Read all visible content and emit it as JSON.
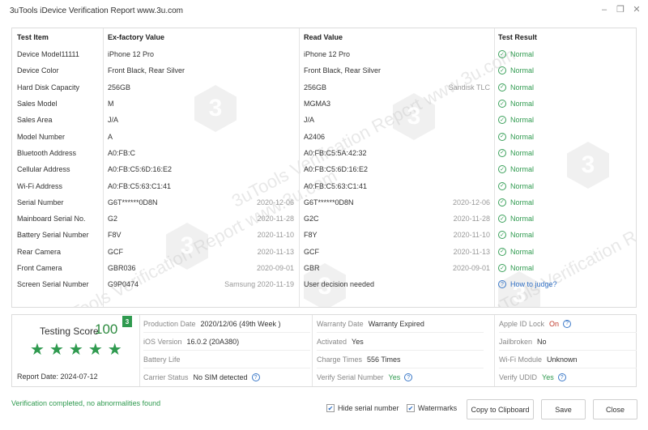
{
  "window": {
    "title": "3uTools iDevice Verification Report www.3u.com",
    "minimize_icon": "minimize-icon",
    "restore_icon": "restore-icon",
    "close_icon": "close-icon"
  },
  "table": {
    "headers": {
      "item": "Test Item",
      "ex_factory": "Ex-factory Value",
      "read": "Read Value",
      "result": "Test Result"
    },
    "rows": [
      {
        "item": "Device Model11111",
        "ex": "iPhone 12 Pro",
        "ex_sub": "",
        "read": "iPhone 12 Pro",
        "read_sub": "",
        "result": "Normal",
        "status": "ok"
      },
      {
        "item": "Device Color",
        "ex": "Front Black,  Rear Silver",
        "ex_sub": "",
        "read": "Front Black,  Rear Silver",
        "read_sub": "",
        "result": "Normal",
        "status": "ok"
      },
      {
        "item": "Hard Disk Capacity",
        "ex": "256GB",
        "ex_sub": "",
        "read": "256GB",
        "read_sub": "Sandisk TLC",
        "result": "Normal",
        "status": "ok"
      },
      {
        "item": "Sales Model",
        "ex": "M",
        "ex_sub": "",
        "read": "MGMA3",
        "read_sub": "",
        "result": "Normal",
        "status": "ok"
      },
      {
        "item": "Sales Area",
        "ex": "J/A",
        "ex_sub": "",
        "read": "J/A",
        "read_sub": "",
        "result": "Normal",
        "status": "ok"
      },
      {
        "item": "Model Number",
        "ex": "A",
        "ex_sub": "",
        "read": "A2406",
        "read_sub": "",
        "result": "Normal",
        "status": "ok"
      },
      {
        "item": "Bluetooth Address",
        "ex": "A0:FB:C",
        "ex_sub": "",
        "read": "A0:FB:C5:5A:42:32",
        "read_sub": "",
        "result": "Normal",
        "status": "ok"
      },
      {
        "item": "Cellular Address",
        "ex": "A0:FB:C5:6D:16:E2",
        "ex_sub": "",
        "read": "A0:FB:C5:6D:16:E2",
        "read_sub": "",
        "result": "Normal",
        "status": "ok"
      },
      {
        "item": "Wi-Fi Address",
        "ex": "A0:FB:C5:63:C1:41",
        "ex_sub": "",
        "read": "A0:FB:C5:63:C1:41",
        "read_sub": "",
        "result": "Normal",
        "status": "ok"
      },
      {
        "item": "Serial Number",
        "ex": "G6T******0D8N",
        "ex_sub": "2020-12-06",
        "read": "G6T******0D8N",
        "read_sub": "2020-12-06",
        "result": "Normal",
        "status": "ok"
      },
      {
        "item": "Mainboard Serial No.",
        "ex": "G2",
        "ex_sub": "2020-11-28",
        "read": "G2C",
        "read_sub": "2020-11-28",
        "result": "Normal",
        "status": "ok"
      },
      {
        "item": "Battery Serial Number",
        "ex": "F8V",
        "ex_sub": "2020-11-10",
        "read": "F8Y",
        "read_sub": "2020-11-10",
        "result": "Normal",
        "status": "ok"
      },
      {
        "item": "Rear Camera",
        "ex": "GCF",
        "ex_sub": "2020-11-13",
        "read": "GCF",
        "read_sub": "2020-11-13",
        "result": "Normal",
        "status": "ok"
      },
      {
        "item": "Front Camera",
        "ex": "GBR036",
        "ex_sub": "2020-09-01",
        "read": "GBR",
        "read_sub": "2020-09-01",
        "result": "Normal",
        "status": "ok"
      },
      {
        "item": "Screen Serial Number",
        "ex": "G9P0474",
        "ex_sub": "Samsung 2020-11-19",
        "read": "User decision needed",
        "read_sub": "",
        "result": "How to judge?",
        "status": "question"
      }
    ]
  },
  "summary": {
    "score_label": "Testing Score",
    "score_value": "100",
    "score_badge": "3",
    "stars": 5,
    "report_date_label": "Report Date:",
    "report_date": "2024-07-12",
    "fields": [
      {
        "label": "Production Date",
        "value": "2020/12/06 (49th Week )",
        "style": ""
      },
      {
        "label": "Warranty Date",
        "value": "Warranty Expired",
        "style": ""
      },
      {
        "label": "Apple ID Lock",
        "value": "On",
        "style": "red",
        "icon": "info-icon"
      },
      {
        "label": "iOS Version",
        "value": "16.0.2 (20A380)",
        "style": ""
      },
      {
        "label": "Activated",
        "value": "Yes",
        "style": ""
      },
      {
        "label": "Jailbroken",
        "value": "No",
        "style": ""
      },
      {
        "label": "Battery Life",
        "value": "",
        "style": ""
      },
      {
        "label": "Charge Times",
        "value": "556 Times",
        "style": ""
      },
      {
        "label": "Wi-Fi Module",
        "value": "Unknown",
        "style": ""
      },
      {
        "label": "Carrier Status",
        "value": "No SIM detected",
        "style": "",
        "icon": "question-icon"
      },
      {
        "label": "Verify Serial Number",
        "value": "Yes",
        "style": "green",
        "icon": "question-icon"
      },
      {
        "label": "Verify UDID",
        "value": "Yes",
        "style": "green",
        "icon": "question-icon"
      }
    ]
  },
  "footer": {
    "status": "Verification completed, no abnormalities found",
    "hide_serial_label": "Hide serial number",
    "watermarks_label": "Watermarks",
    "copy_label": "Copy to Clipboard",
    "save_label": "Save",
    "close_label": "Close"
  },
  "watermark_text": "3uTools Verification Report www.3u.com",
  "colors": {
    "normal_green": "#2f9a4f",
    "link_blue": "#2f6fc4",
    "lock_red": "#c0392b"
  }
}
